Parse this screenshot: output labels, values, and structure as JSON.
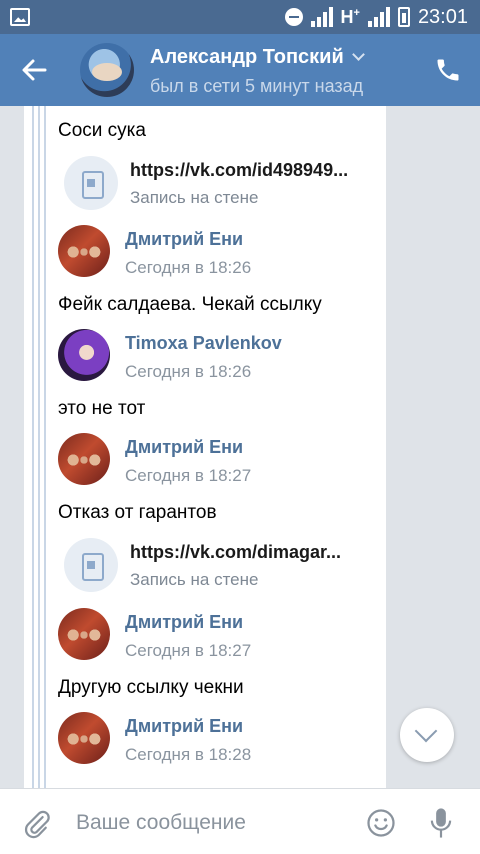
{
  "status_bar": {
    "network": "H",
    "time": "23:01"
  },
  "header": {
    "name": "Александр Топский",
    "status": "был в сети 5 минут назад",
    "icons": {
      "back": "back-arrow-icon",
      "call": "phone-icon",
      "expand": "chevron-down-icon"
    }
  },
  "messages": {
    "m1": {
      "text": "Соси сука"
    },
    "att1": {
      "url": "https://vk.com/id498949...",
      "label": "Запись на стене"
    },
    "s1": {
      "name": "Дмитрий Ени",
      "time": "Сегодня в 18:26"
    },
    "m2": {
      "text": "Фейк салдаева. Чекай ссылку"
    },
    "s2": {
      "name": "Timoxa Pavlenkov",
      "time": "Сегодня в 18:26"
    },
    "m3": {
      "text": "это не тот"
    },
    "s3": {
      "name": "Дмитрий Ени",
      "time": "Сегодня в 18:27"
    },
    "m4": {
      "text": "Отказ от гарантов"
    },
    "att2": {
      "url": "https://vk.com/dimagar...",
      "label": "Запись на стене"
    },
    "s4": {
      "name": "Дмитрий Ени",
      "time": "Сегодня в 18:27"
    },
    "m5": {
      "text": "Другую ссылку чекни"
    },
    "s5": {
      "name": "Дмитрий Ени",
      "time": "Сегодня в 18:28"
    }
  },
  "composer": {
    "placeholder": "Ваше сообщение",
    "value": "",
    "icons": {
      "attach": "paperclip-icon",
      "emoji": "smile-icon",
      "voice": "microphone-icon"
    }
  },
  "colors": {
    "header": "#5181b8",
    "status_bar": "#4a6a91",
    "link_name": "#4d7198"
  }
}
